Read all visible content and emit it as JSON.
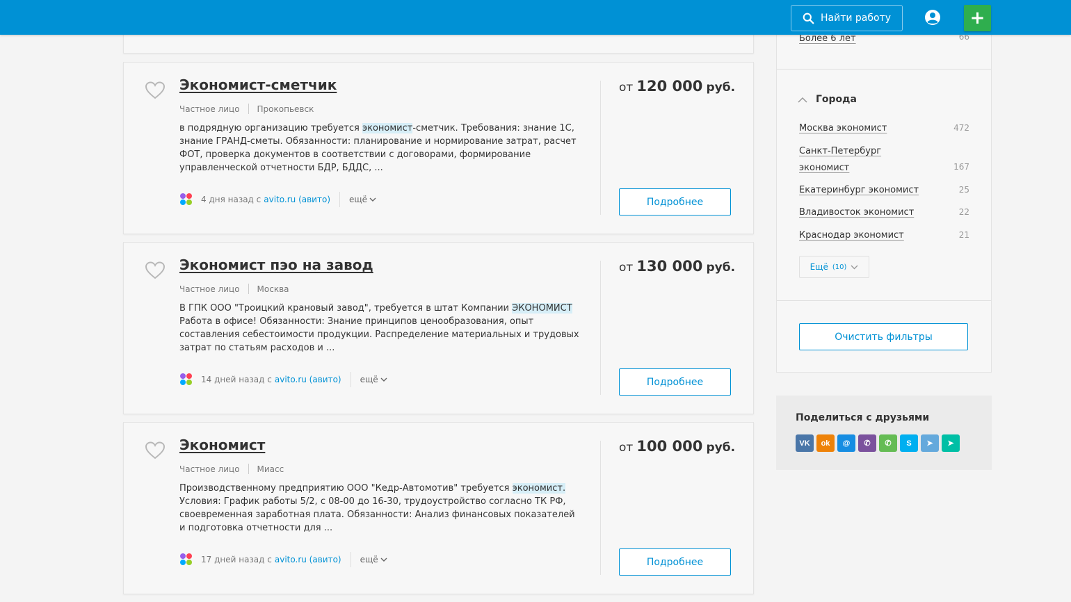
{
  "header": {
    "find_job_label": "Найти работу",
    "plus_label": "+"
  },
  "jobs": [
    {
      "title": "Экономист-сметчик",
      "employer_type": "Частное лицо",
      "city": "Прокопьевск",
      "desc_before": "в подрядную организацию требуется ",
      "desc_highlight": "экономист",
      "desc_after": "-сметчик. Требования: знание 1С, знание ГРАНД-сметы. Обязанности: планирование и нормирование затрат, расчет ФОТ, проверка документов в соответствии с договорами, формирование управленческой отчетности БДР, БДДС, ...",
      "posted": "4 дня назад с",
      "source": "avito.ru (авито)",
      "more_label": "ещё",
      "salary_from": "от",
      "salary_value": "120 000",
      "salary_currency": "руб.",
      "details_label": "Подробнее"
    },
    {
      "title": "Экономист пэо на завод",
      "employer_type": "Частное лицо",
      "city": "Москва",
      "desc_before": "В ГПК ООО \"Троицкий крановый завод\", требуется в штат Компании ",
      "desc_highlight": "ЭКОНОМИСТ",
      "desc_after": " Работа в офисе! Обязанности: Знание принципов ценообразования, опыт составления себестоимости продукции. Распределение материальных и трудовых затрат по статьям расходов и ...",
      "posted": "14 дней назад с",
      "source": "avito.ru (авито)",
      "more_label": "ещё",
      "salary_from": "от",
      "salary_value": "130 000",
      "salary_currency": "руб.",
      "details_label": "Подробнее"
    },
    {
      "title": "Экономист",
      "employer_type": "Частное лицо",
      "city": "Миасс",
      "desc_before": "Производственному предприятию ООО \"Кедр-Автомотив\" требуется ",
      "desc_highlight": "экономист.",
      "desc_after": " Условия: График работы 5/2, с 08-00 до 16-30, трудоустройство согласно ТК РФ, своевременная заработная плата. Обязанности: Анализ финансовых показателей и подготовка отчетности для ...",
      "posted": "17 дней назад с",
      "source": "avito.ru (авито)",
      "more_label": "ещё",
      "salary_from": "от",
      "salary_value": "100 000",
      "salary_currency": "руб.",
      "details_label": "Подробнее"
    }
  ],
  "sidebar": {
    "experience_item": {
      "label": "Более 6 лет",
      "count": "66"
    },
    "cities_title": "Города",
    "cities": [
      {
        "label": "Москва экономист",
        "count": "472"
      },
      {
        "label_line1": "Санкт-Петербург",
        "label_line2": "экономист",
        "count": "167"
      },
      {
        "label": "Екатеринбург экономист",
        "count": "25"
      },
      {
        "label": "Владивосток экономист",
        "count": "22"
      },
      {
        "label": "Краснодар экономист",
        "count": "21"
      }
    ],
    "more_label": "Ещё",
    "more_count": "(10)",
    "clear_label": "Очистить фильтры"
  },
  "share": {
    "title": "Поделиться с друзьями",
    "icons": [
      {
        "name": "vk-icon",
        "glyph": "VK",
        "color": "#4a76a8"
      },
      {
        "name": "odnoklassniki-icon",
        "glyph": "ok",
        "color": "#ee8208"
      },
      {
        "name": "moimir-icon",
        "glyph": "@",
        "color": "#168de2"
      },
      {
        "name": "viber-icon",
        "glyph": "✆",
        "color": "#7b519d"
      },
      {
        "name": "whatsapp-icon",
        "glyph": "✆",
        "color": "#65bc54"
      },
      {
        "name": "skype-icon",
        "glyph": "S",
        "color": "#00aff0"
      },
      {
        "name": "telegram-icon",
        "glyph": "➤",
        "color": "#64a9dc"
      },
      {
        "name": "send-icon",
        "glyph": "➤",
        "color": "#00bfa5"
      }
    ]
  }
}
